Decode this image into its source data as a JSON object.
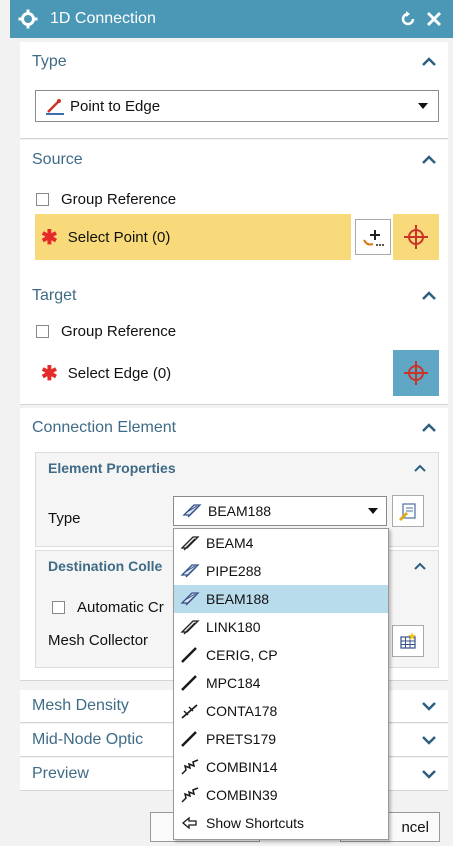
{
  "window": {
    "title": "1D Connection"
  },
  "sections": {
    "type": {
      "label": "Type",
      "value": "Point to Edge"
    },
    "source": {
      "label": "Source",
      "group_reference": "Group Reference",
      "select_point": "Select Point (0)"
    },
    "target": {
      "label": "Target",
      "group_reference": "Group Reference",
      "select_edge": "Select Edge (0)"
    },
    "connection_element": {
      "label": "Connection Element",
      "element_properties": "Element Properties",
      "type_label": "Type",
      "type_value": "BEAM188",
      "destination_collector": "Destination Colle",
      "automatic": "Automatic Cr",
      "mesh_collector": "Mesh Collector"
    },
    "mesh_density": {
      "label": "Mesh Density"
    },
    "mid_node": {
      "label": "Mid-Node Optic"
    },
    "preview": {
      "label": "Preview"
    }
  },
  "dropdown": {
    "items": [
      {
        "label": "BEAM4",
        "icon": "beam-icon"
      },
      {
        "label": "PIPE288",
        "icon": "pipe-icon"
      },
      {
        "label": "BEAM188",
        "icon": "beam188-icon",
        "selected": true
      },
      {
        "label": "LINK180",
        "icon": "link-icon"
      },
      {
        "label": "CERIG, CP",
        "icon": "line-icon"
      },
      {
        "label": "MPC184",
        "icon": "line-icon"
      },
      {
        "label": "CONTA178",
        "icon": "contact-icon"
      },
      {
        "label": "PRETS179",
        "icon": "line-icon"
      },
      {
        "label": "COMBIN14",
        "icon": "spring-icon"
      },
      {
        "label": "COMBIN39",
        "icon": "spring-icon"
      },
      {
        "label": "Show Shortcuts",
        "icon": "arrow-left-icon"
      }
    ]
  },
  "footer": {
    "cancel_label": "ncel"
  },
  "colors": {
    "titlebar": "#4a97b6",
    "highlight": "#f8da7b",
    "selected_row": "#b9dcec",
    "section_text": "#3f6b86"
  }
}
